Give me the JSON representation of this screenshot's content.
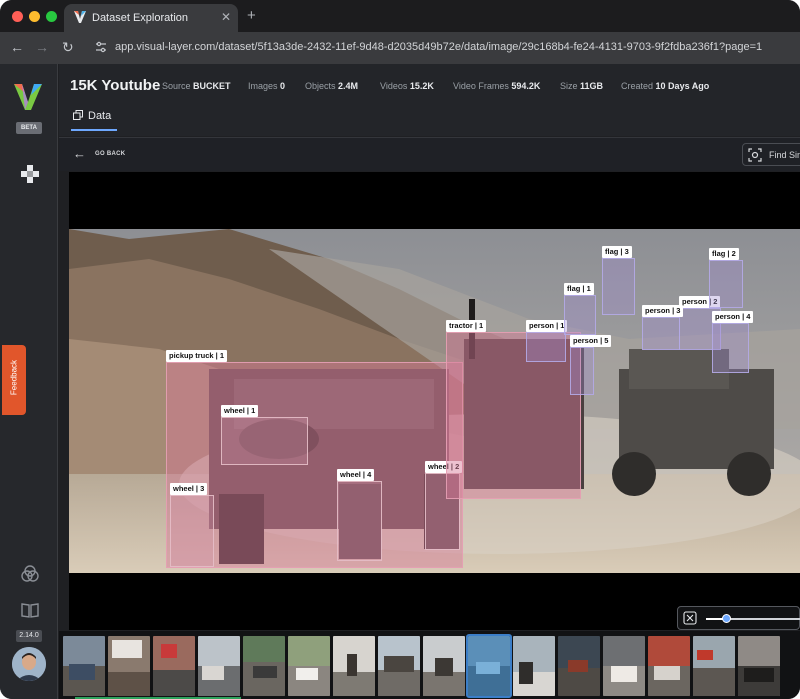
{
  "browser": {
    "tab_title": "Dataset Exploration",
    "tab_close": "✕",
    "new_tab": "+",
    "url": "app.visual-layer.com/dataset/5f13a3de-2432-11ef-9d48-d2035d49b72e/data/image/29c168b4-fe24-4131-9703-9f2fdba236f1?page=1",
    "back_icon": "←",
    "forward_icon": "→",
    "reload_icon": "↻"
  },
  "sidebar": {
    "beta": "BETA",
    "feedback": "Feedback",
    "version": "2.14.0"
  },
  "header": {
    "title": "15K Youtube",
    "meta": [
      {
        "label": "Source",
        "value": "BUCKET"
      },
      {
        "label": "Images",
        "value": "0"
      },
      {
        "label": "Objects",
        "value": "2.4M"
      },
      {
        "label": "Videos",
        "value": "15.2K"
      },
      {
        "label": "Video Frames",
        "value": "594.2K"
      },
      {
        "label": "Size",
        "value": "11GB"
      },
      {
        "label": "Created",
        "value": "10 Days Ago"
      }
    ],
    "tab": "Data"
  },
  "toolbar": {
    "back_arrow": "←",
    "go_back": "GO BACK",
    "find_similar": "Find Sim"
  },
  "detections": [
    {
      "label": "pickup truck | 1",
      "style": "pink"
    },
    {
      "label": "wheel | 1",
      "style": "wheel"
    },
    {
      "label": "wheel | 2",
      "style": "wheel"
    },
    {
      "label": "wheel | 3",
      "style": "wheel"
    },
    {
      "label": "wheel | 4",
      "style": "wheel"
    },
    {
      "label": "tractor | 1",
      "style": "pink"
    },
    {
      "label": "person | 1",
      "style": "lilac"
    },
    {
      "label": "person | 2",
      "style": "lilac"
    },
    {
      "label": "person | 3",
      "style": "lilac"
    },
    {
      "label": "person | 4",
      "style": "lilac"
    },
    {
      "label": "person | 5",
      "style": "lilac"
    },
    {
      "label": "flag | 1",
      "style": "lilac"
    },
    {
      "label": "flag | 2",
      "style": "lilac"
    },
    {
      "label": "flag | 3",
      "style": "lilac"
    }
  ],
  "colors": {
    "accent": "#6ea8fe",
    "feedback": "#e1562b",
    "selected_thumb": "#3b7ec8",
    "progress": "#2ea35d"
  }
}
